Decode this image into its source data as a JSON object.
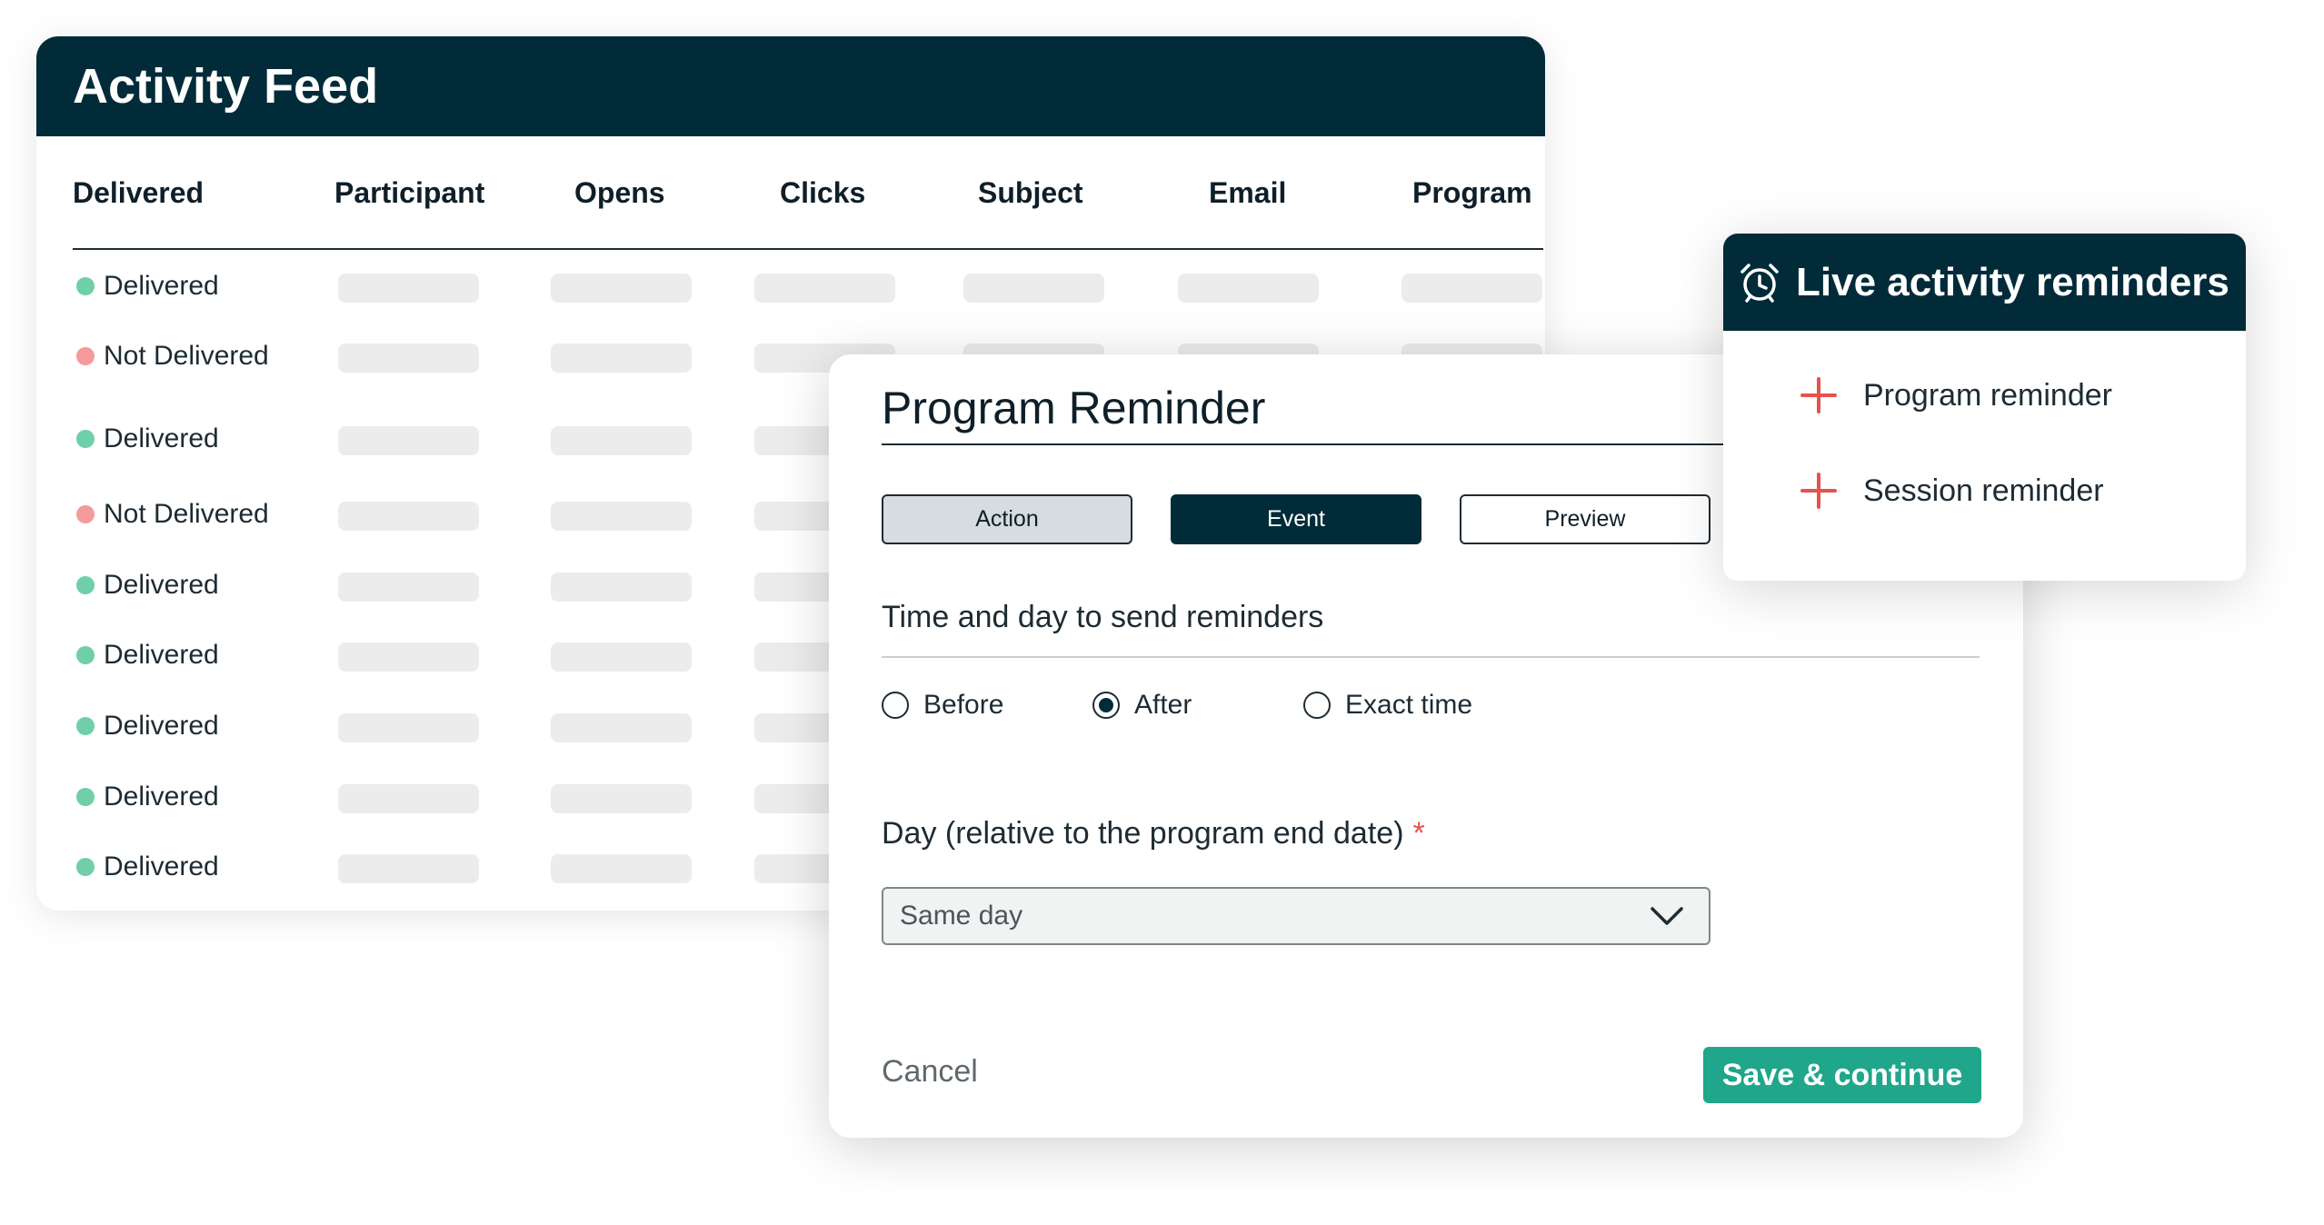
{
  "activity_feed": {
    "title": "Activity Feed",
    "columns": [
      "Delivered",
      "Participant",
      "Opens",
      "Clicks",
      "Subject",
      "Email",
      "Program"
    ],
    "rows": [
      {
        "status": "Delivered",
        "state": "ok"
      },
      {
        "status": "Not Delivered",
        "state": "bad"
      },
      {
        "status": "Delivered",
        "state": "ok"
      },
      {
        "status": "Not Delivered",
        "state": "bad"
      },
      {
        "status": "Delivered",
        "state": "ok"
      },
      {
        "status": "Delivered",
        "state": "ok"
      },
      {
        "status": "Delivered",
        "state": "ok"
      },
      {
        "status": "Delivered",
        "state": "ok"
      },
      {
        "status": "Delivered",
        "state": "ok"
      }
    ]
  },
  "modal": {
    "title": "Program Reminder",
    "tabs": {
      "action": "Action",
      "event": "Event",
      "preview": "Preview"
    },
    "active_tab": "Event",
    "time_section_label": "Time and day to send reminders",
    "radio_options": [
      "Before",
      "After",
      "Exact time"
    ],
    "selected_radio": "After",
    "day_label": "Day (relative to the program end date)",
    "required_marker": "*",
    "day_select_value": "Same day",
    "cancel_label": "Cancel",
    "save_label": "Save & continue"
  },
  "live_reminders": {
    "title": "Live activity reminders",
    "items": [
      "Program reminder",
      "Session reminder"
    ]
  },
  "colors": {
    "header_dark": "#022b3a",
    "delivered_dot": "#6fcfa9",
    "not_delivered_dot": "#f49a9a",
    "save_button": "#1fa68b",
    "plus_icon": "#e5534b",
    "required_marker": "#e5534b"
  },
  "icons": {
    "live_header": "alarm-clock-icon",
    "live_item": "plus-icon",
    "select": "chevron-down-icon"
  }
}
